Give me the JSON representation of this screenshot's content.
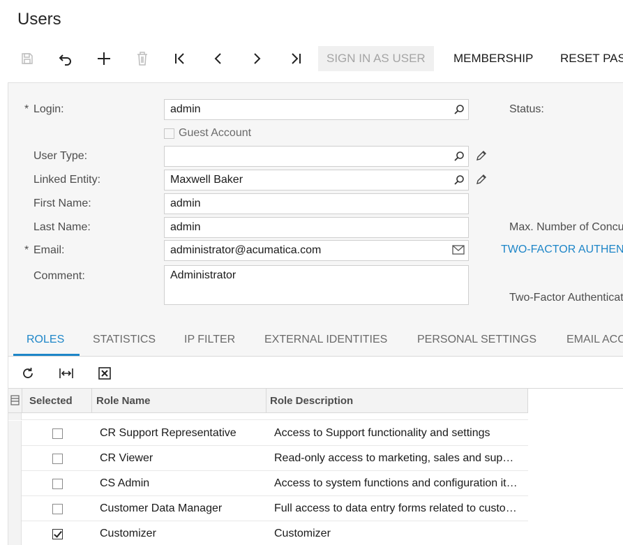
{
  "page": {
    "title": "Users"
  },
  "toolbar": {
    "icons": [
      "save-icon",
      "undo-icon",
      "add-icon",
      "delete-icon",
      "first-record-icon",
      "previous-record-icon",
      "next-record-icon",
      "last-record-icon"
    ],
    "sign_in_as_user": "SIGN IN AS USER",
    "membership": "MEMBERSHIP",
    "reset_password": "RESET PAS"
  },
  "form": {
    "login": {
      "label": "Login:",
      "value": "admin",
      "required": "*"
    },
    "guest_account": {
      "label": "Guest Account",
      "checked": false
    },
    "user_type": {
      "label": "User Type:",
      "value": ""
    },
    "linked_entity": {
      "label": "Linked Entity:",
      "value": "Maxwell Baker"
    },
    "first_name": {
      "label": "First Name:",
      "value": "admin"
    },
    "last_name": {
      "label": "Last Name:",
      "value": "admin"
    },
    "email": {
      "label": "Email:",
      "value": "administrator@acumatica.com",
      "required": "*"
    },
    "comment": {
      "label": "Comment:",
      "value": "Administrator"
    },
    "status": {
      "label": "Status:"
    },
    "max_concurrent": {
      "label": "Max. Number of Concu"
    },
    "two_factor_link": {
      "label": "TWO-FACTOR AUTHEN"
    },
    "two_factor_auth": {
      "label": "Two-Factor Authenticat"
    }
  },
  "tabs": [
    {
      "label": "ROLES",
      "active": true
    },
    {
      "label": "STATISTICS",
      "active": false
    },
    {
      "label": "IP FILTER",
      "active": false
    },
    {
      "label": "EXTERNAL IDENTITIES",
      "active": false
    },
    {
      "label": "PERSONAL SETTINGS",
      "active": false
    },
    {
      "label": "EMAIL ACC",
      "active": false
    }
  ],
  "grid_toolbar": {
    "icons": [
      "refresh-icon",
      "fit-columns-icon",
      "export-excel-icon"
    ]
  },
  "grid": {
    "columns": [
      "Selected",
      "Role Name",
      "Role Description"
    ],
    "rows": [
      {
        "selected": false,
        "role_name": "CR Support Representative",
        "description": "Access to Support functionality and settings"
      },
      {
        "selected": false,
        "role_name": "CR Viewer",
        "description": "Read-only access to marketing, sales and support"
      },
      {
        "selected": false,
        "role_name": "CS Admin",
        "description": "Access to system functions and configuration items"
      },
      {
        "selected": false,
        "role_name": "Customer Data Manager",
        "description": "Full access to data entry forms related to customers"
      },
      {
        "selected": true,
        "role_name": "Customizer",
        "description": "Customizer"
      }
    ]
  },
  "colors": {
    "accent": "#1e86c8",
    "panel": "#f6f6f6",
    "disabled": "#a5a5a5"
  }
}
